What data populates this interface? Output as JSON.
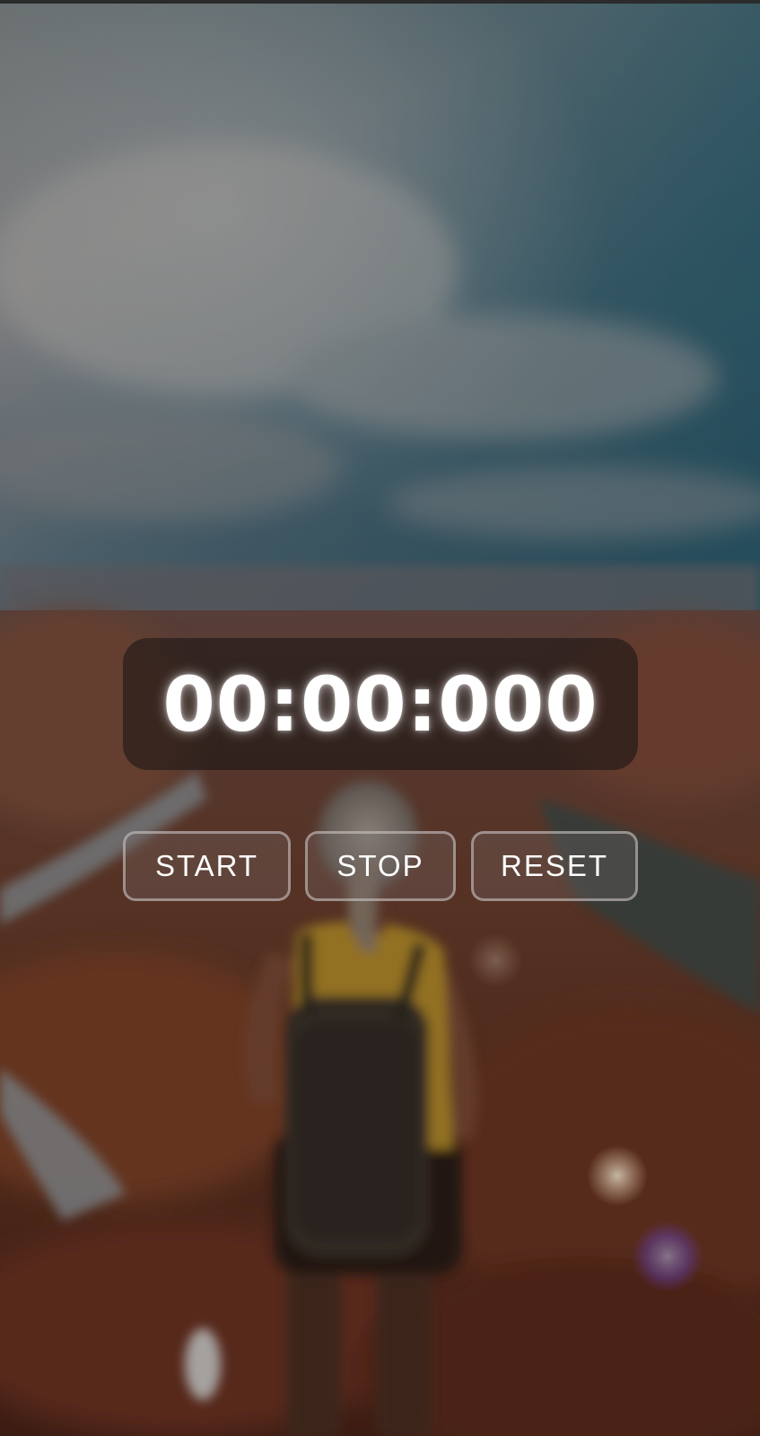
{
  "timer": {
    "display": "00:00:000"
  },
  "controls": {
    "start_label": "START",
    "stop_label": "STOP",
    "reset_label": "RESET"
  },
  "background": {
    "description_icon": "canyon-hiker-photo"
  }
}
